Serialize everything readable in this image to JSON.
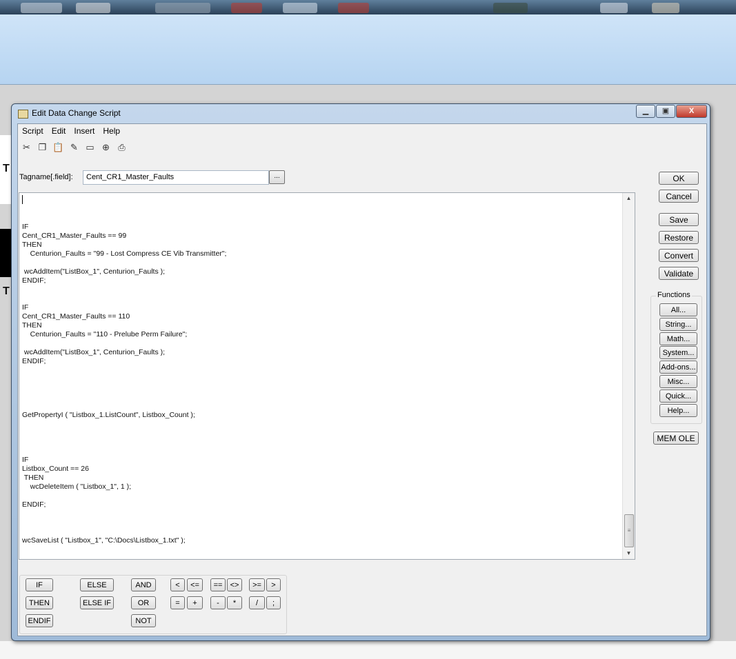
{
  "dialog": {
    "title": "Edit Data Change Script",
    "window_buttons": {
      "minimize": "▁",
      "maximize": "▣",
      "close": "X"
    }
  },
  "menu": [
    "Script",
    "Edit",
    "Insert",
    "Help"
  ],
  "toolbar": [
    "cut-icon",
    "copy-icon",
    "paste-icon",
    "tag-icon",
    "window-icon",
    "convert-icon",
    "print-icon"
  ],
  "tagname": {
    "label": "Tagname[.field]:",
    "value": "Cent_CR1_Master_Faults",
    "browse": "..."
  },
  "script_text": "\n\n\nIF\nCent_CR1_Master_Faults == 99\nTHEN\n    Centurion_Faults = \"99 - Lost Compress CE Vib Transmitter\";\n\n wcAddItem(\"ListBox_1\", Centurion_Faults );\nENDIF;\n\n\nIF\nCent_CR1_Master_Faults == 110\nTHEN\n    Centurion_Faults = \"110 - Prelube Perm Failure\";\n\n wcAddItem(\"ListBox_1\", Centurion_Faults );\nENDIF;\n\n\n\n\n\nGetPropertyI ( \"Listbox_1.ListCount\", Listbox_Count );\n\n\n\n\nIF\nListbox_Count == 26\n THEN\n    wcDeleteItem ( \"Listbox_1\", 1 );\n\nENDIF;\n\n\n\nwcSaveList ( \"Listbox_1\", \"C:\\Docs\\Listbox_1.txt\" );",
  "side_buttons": {
    "ok": "OK",
    "cancel": "Cancel",
    "save": "Save",
    "restore": "Restore",
    "convert": "Convert",
    "validate": "Validate"
  },
  "functions": {
    "title": "Functions",
    "all": "All...",
    "string": "String...",
    "math": "Math...",
    "system": "System...",
    "addons": "Add-ons...",
    "misc": "Misc...",
    "quick": "Quick...",
    "help": "Help..."
  },
  "mem_ole": "MEM OLE",
  "operators": {
    "if": "IF",
    "then": "THEN",
    "endif": "ENDIF",
    "else": "ELSE",
    "elseif": "ELSE IF",
    "and": "AND",
    "or": "OR",
    "not": "NOT",
    "lt": "<",
    "le": "<=",
    "eq": "==",
    "ne": "<>",
    "ge": ">=",
    "gt": ">",
    "assign": "=",
    "plus": "+",
    "minus": "-",
    "times": "*",
    "divide": "/",
    "semicolon": ";"
  },
  "background": {
    "text_1": "T",
    "text_2": "T C"
  }
}
